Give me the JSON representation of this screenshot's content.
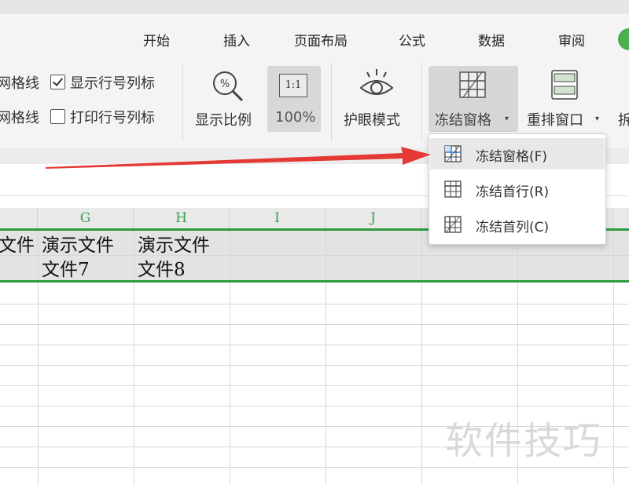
{
  "ribbon": {
    "tabs": [
      "开始",
      "插入",
      "页面布局",
      "公式",
      "数据",
      "审阅"
    ],
    "checkboxes": [
      {
        "label": "网格线",
        "checked": true
      },
      {
        "label": "显示行号列标",
        "checked": true
      },
      {
        "label": "网格线",
        "checked": false
      },
      {
        "label": "打印行号列标",
        "checked": false
      }
    ],
    "zoom_label": "显示比例",
    "zoom_100_icon": "1:1",
    "zoom_100_label": "100%",
    "eye_mode_label": "护眼模式",
    "freeze_label": "冻结窗格",
    "arrange_label": "重排窗口",
    "cut_label": "拆"
  },
  "dropdown": {
    "items": [
      {
        "label": "冻结窗格(F)",
        "icon": "freeze-panes-icon",
        "selected": true
      },
      {
        "label": "冻结首行(R)",
        "icon": "freeze-top-row-icon",
        "selected": false
      },
      {
        "label": "冻结首列(C)",
        "icon": "freeze-first-column-icon",
        "selected": false
      }
    ]
  },
  "sheet": {
    "columns": [
      "G",
      "H",
      "I",
      "J"
    ],
    "row1": {
      "f_tail": "文件",
      "g_line1": "演示文件",
      "g_line2": "文件7",
      "h_line1": "演示文件",
      "h_line2": "文件8"
    }
  },
  "watermark": "软件技巧",
  "colors": {
    "accent_green": "#2e9b3e",
    "arrow_red": "#e53935",
    "column_letter_green": "#3aa04a"
  }
}
